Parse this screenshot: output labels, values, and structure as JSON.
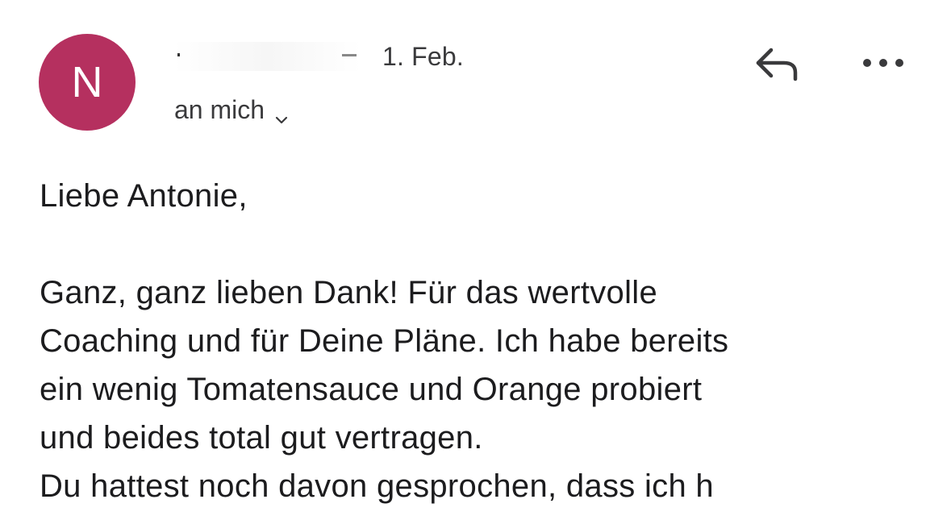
{
  "header": {
    "avatar_initial": "N",
    "avatar_color": "#b5305f",
    "sender_name": "",
    "date": "1. Feb.",
    "recipient": "an mich",
    "icons": {
      "recipient_toggle": "chevron-down-icon",
      "reply": "reply-icon",
      "more": "more-options-icon"
    }
  },
  "message": {
    "greeting": "Liebe Antonie,",
    "lines": [
      "Ganz, ganz lieben Dank! Für das wertvolle",
      "Coaching und für Deine Pläne. Ich habe bereits",
      "ein wenig Tomatensauce und Orange probiert",
      "und beides total gut vertragen.",
      "Du hattest noch davon gesprochen,  dass ich h"
    ]
  }
}
